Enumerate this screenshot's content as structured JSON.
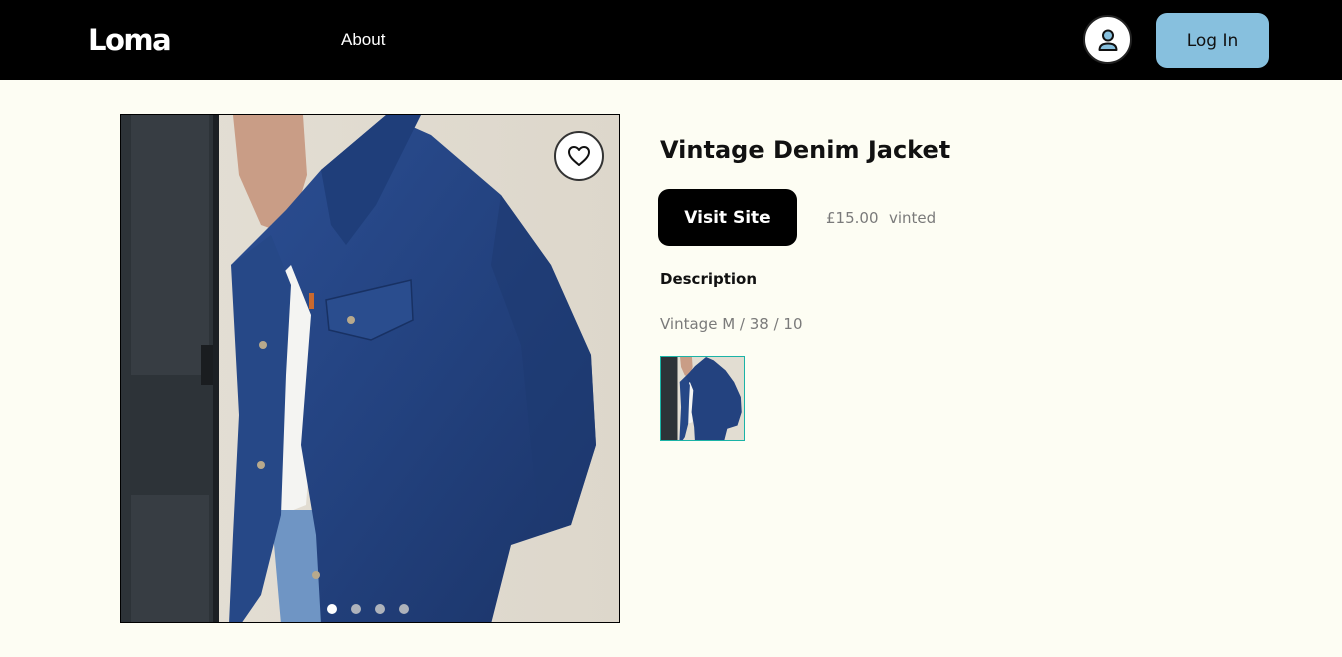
{
  "header": {
    "logo": "Loma",
    "nav": {
      "about_label": "About"
    },
    "profile_icon": "user-icon",
    "login_label": "Log In",
    "login_color": "#87c0de"
  },
  "product": {
    "title": "Vintage Denim Jacket",
    "visit_label": "Visit Site",
    "price": "£15.00",
    "source": "vinted",
    "description_heading": "Description",
    "description": "Vintage M / 38 / 10",
    "favorite_icon": "heart-icon",
    "gallery": {
      "image_count": 4,
      "active_index": 0,
      "thumbnail_count": 1
    },
    "accent_color": "#1ab3a6"
  }
}
